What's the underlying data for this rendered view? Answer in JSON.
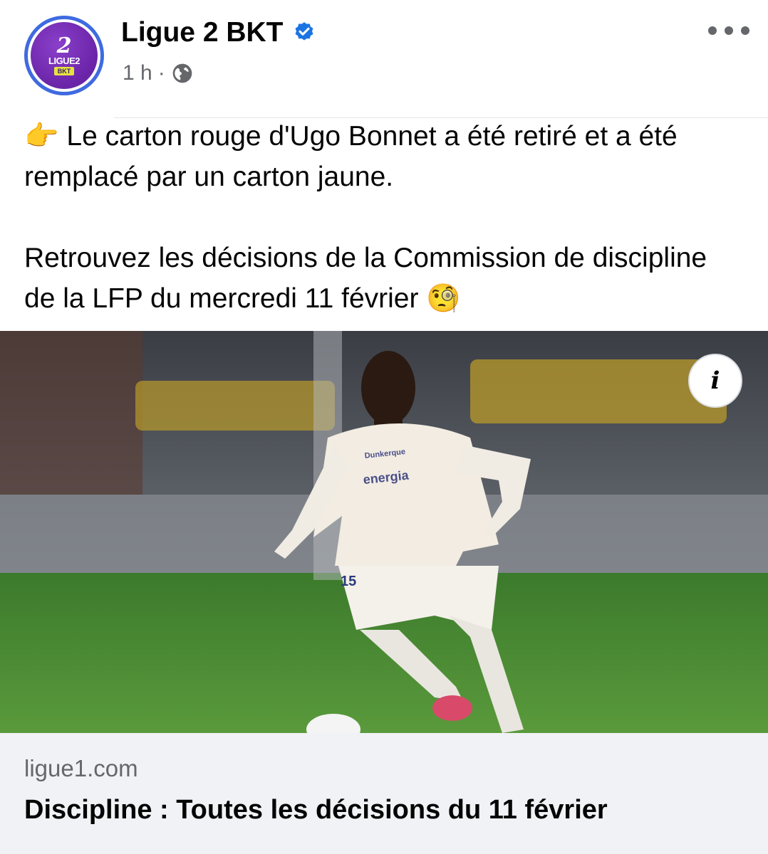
{
  "page": {
    "name": "Ligue 2 BKT",
    "time": "1 h",
    "separator": "·",
    "logo": {
      "number": "2",
      "text": "LIGUE2",
      "badge": "BKT"
    }
  },
  "post": {
    "line1": "👉 Le carton rouge d'Ugo Bonnet a été retiré et a été remplacé par un carton jaune.",
    "line2": "Retrouvez les décisions de la Commission de discipline de la LFP du mercredi 11 février 🧐"
  },
  "photo": {
    "jersey_sponsor": "energia",
    "jersey_club": "Dunkerque",
    "shorts_number": "15"
  },
  "info_button": {
    "label": "i"
  },
  "link": {
    "domain": "ligue1.com",
    "title": "Discipline : Toutes les décisions du 11 février"
  },
  "icons": {
    "verified": "verified-badge-icon",
    "globe": "globe-icon",
    "more": "more-options-icon"
  },
  "colors": {
    "verified_blue": "#1b74e4",
    "logo_purple": "#6a24a8",
    "avatar_ring": "#3f6ae0",
    "link_bg": "#f0f2f5",
    "secondary_text": "#65676b"
  }
}
